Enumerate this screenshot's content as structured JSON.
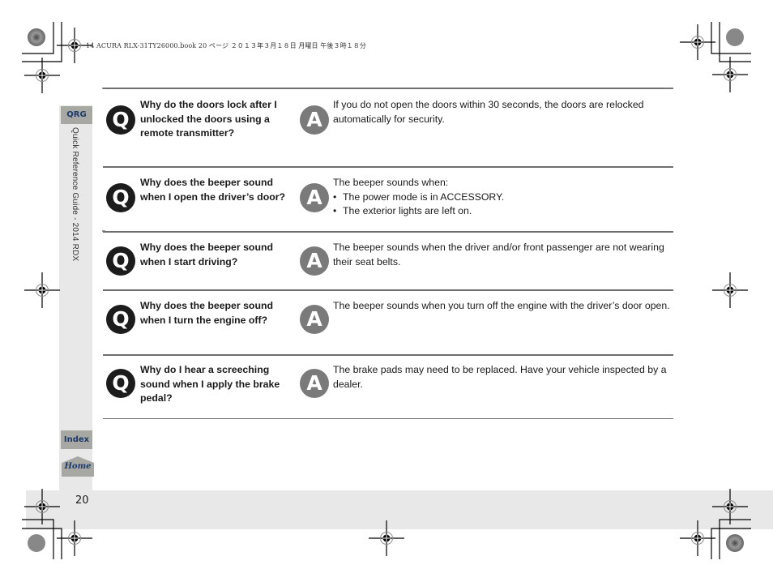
{
  "header": {
    "slug": "14 ACURA RLX-31TY26000.book  20 ページ  ２０１３年３月１８日  月曜日  午後３時１８分"
  },
  "side_nav": {
    "qrg_tab": "QRG",
    "section_title": "Quick Reference Guide - 2014 RDX",
    "index_tab": "Index",
    "home_tab": "Home"
  },
  "page": {
    "number": "20"
  },
  "qa": {
    "q_icon": "Q",
    "a_icon": "A",
    "items": [
      {
        "question": "Why do the doors lock after I unlocked the doors using a remote transmitter?",
        "answer": "If you do not open the doors within 30 seconds, the doors are relocked automatically for security.",
        "bullets": []
      },
      {
        "question": "Why does the beeper sound when I open the driver’s door?",
        "answer": "The beeper sounds when:",
        "bullets": [
          "The power mode is in ACCESSORY.",
          "The exterior lights are left on."
        ]
      },
      {
        "question": "Why does the beeper sound when I start driving?",
        "answer": "The beeper sounds when the driver and/or front passenger are not wearing their seat belts.",
        "bullets": []
      },
      {
        "question": "Why does the beeper sound when I turn the engine off?",
        "answer": "The beeper sounds when you turn off the engine with the driver’s door open.",
        "bullets": []
      },
      {
        "question": "Why do I hear a screeching sound when I apply the brake pedal?",
        "answer": "The brake pads may need to be replaced. Have your vehicle inspected by a dealer.",
        "bullets": []
      }
    ]
  },
  "colors": {
    "tab_gray": "#a7a8a3",
    "tab_text_navy": "#1b3a6b",
    "q_badge": "#1c1c1c",
    "a_badge": "#7a7a7a",
    "rule": "#6e6e6e",
    "band_gray": "#e8e8e8"
  }
}
